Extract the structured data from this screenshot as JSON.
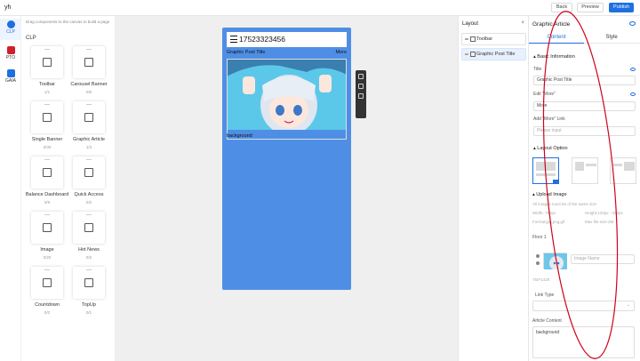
{
  "app": {
    "title": "yh"
  },
  "topbar": {
    "back": "Back",
    "preview": "Preview",
    "publish": "Publish"
  },
  "rail": [
    {
      "label": "CLP",
      "icon": "clp-icon",
      "color": "#1f6fe0"
    },
    {
      "label": "PTO",
      "icon": "pto-icon",
      "color": "#d0212b"
    },
    {
      "label": "GAIA",
      "icon": "gaia-icon",
      "color": "#1f6fe0"
    }
  ],
  "components": {
    "hint": "Drag components to the canvas to build a page",
    "group": "CLP",
    "items": [
      {
        "name": "Toolbar",
        "count": "1/1",
        "icon": "toolbar-icon"
      },
      {
        "name": "Carousel Banner",
        "count": "0/5",
        "icon": "carousel-icon"
      },
      {
        "name": "Single Banner",
        "count": "0/30",
        "icon": "image-banner-icon"
      },
      {
        "name": "Graphic Article",
        "count": "1/3",
        "icon": "article-icon"
      },
      {
        "name": "Balance Dashboard",
        "count": "0/6",
        "icon": "dashboard-icon"
      },
      {
        "name": "Quick Access",
        "count": "0/2",
        "icon": "quick-access-icon"
      },
      {
        "name": "Image",
        "count": "0/20",
        "icon": "image-icon"
      },
      {
        "name": "Hot News",
        "count": "0/2",
        "icon": "news-icon"
      },
      {
        "name": "Countdown",
        "count": "0/2",
        "icon": "countdown-icon"
      },
      {
        "name": "TopUp",
        "count": "0/1",
        "icon": "topup-icon"
      }
    ]
  },
  "canvas": {
    "phone_number": "17523323456",
    "section_title": "Graphic Post Title",
    "more": "More",
    "caption": "background"
  },
  "layout": {
    "title": "Layout",
    "close": "×",
    "items": [
      {
        "label": "Toolbar",
        "active": false
      },
      {
        "label": "Graphic Post Title",
        "active": true
      }
    ]
  },
  "props": {
    "title": "Graphic Article",
    "tabs": [
      "Content",
      "Style"
    ],
    "basic_info": "Basic Information",
    "title_label": "Title",
    "title_value": "Graphic Post Title",
    "edit_more_label": "Edit \"More\"",
    "edit_more_value": "More",
    "add_more_link_label": "Add \"More\" Link",
    "add_more_link_placeholder": "Please input",
    "layout_option": "Layout Option",
    "upload_image": "Upload Image",
    "upload_note": "All images must be of the same size",
    "width_note": "Width: 750px",
    "height_note": "Height:120px - 330px",
    "format_note": "Format:jpg,png,gif",
    "max_note": "Max file size:2M",
    "floor_label": "Floor 1",
    "image_name_placeholder": "Image Name",
    "size_note": "750*1429",
    "link_type_label": "Link Type",
    "article_content_label": "Article Content",
    "article_content_value": "background"
  },
  "colors": {
    "accent": "#1f6fe0",
    "phone_bg": "#4e8fe5",
    "annotation": "#d0021b"
  }
}
